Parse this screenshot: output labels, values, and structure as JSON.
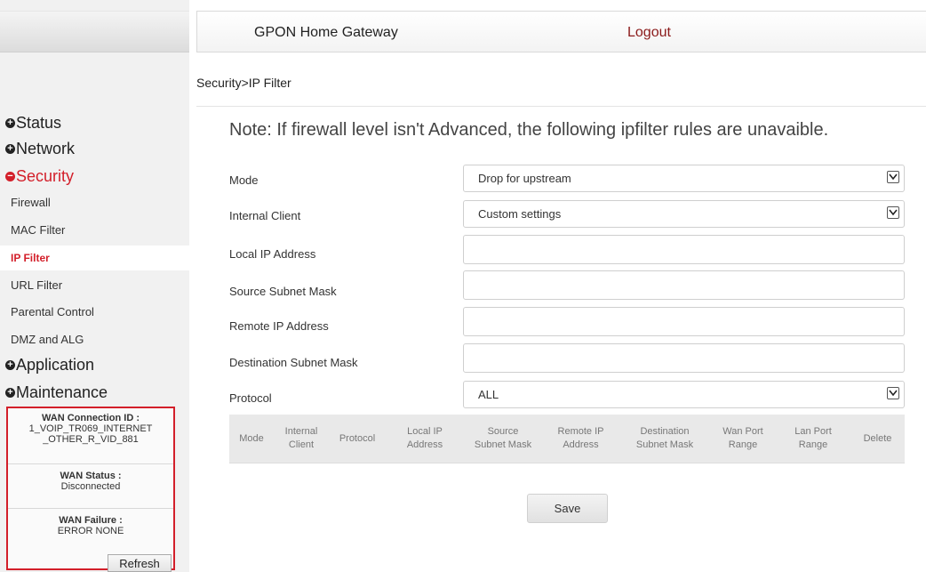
{
  "header": {
    "title": "GPON Home Gateway",
    "logout": "Logout"
  },
  "breadcrumb": "Security>IP Filter",
  "sidebar": {
    "status": "Status",
    "network": "Network",
    "security": "Security",
    "sub": {
      "firewall": "Firewall",
      "mac_filter": "MAC Filter",
      "ip_filter": "IP Filter",
      "url_filter": "URL Filter",
      "parental_control": "Parental Control",
      "dmz_alg": "DMZ and ALG"
    },
    "application": "Application",
    "maintenance": "Maintenance",
    "wan": {
      "conn_id_label": "WAN Connection ID :",
      "conn_id_line1": "1_VOIP_TR069_INTERNET",
      "conn_id_line2": "_OTHER_R_VID_881",
      "status_label": "WAN Status :",
      "status_value": "Disconnected",
      "failure_label": "WAN Failure :",
      "failure_value": "ERROR NONE",
      "refresh": "Refresh"
    }
  },
  "note": "Note: If firewall level isn't Advanced, the following ipfilter rules are unavaible.",
  "form": {
    "mode": {
      "label": "Mode",
      "value": "Drop for upstream"
    },
    "internal_client": {
      "label": "Internal Client",
      "value": "Custom settings"
    },
    "local_ip": {
      "label": "Local IP Address",
      "value": ""
    },
    "source_mask": {
      "label": "Source Subnet Mask",
      "value": ""
    },
    "remote_ip": {
      "label": "Remote IP Address",
      "value": ""
    },
    "dest_mask": {
      "label": "Destination Subnet Mask",
      "value": ""
    },
    "protocol": {
      "label": "Protocol",
      "value": "ALL"
    }
  },
  "table": {
    "columns": {
      "mode": "Mode",
      "internal_client_1": "Internal",
      "internal_client_2": "Client",
      "protocol": "Protocol",
      "local_ip_1": "Local IP",
      "local_ip_2": "Address",
      "source_mask_1": "Source",
      "source_mask_2": "Subnet Mask",
      "remote_ip_1": "Remote IP",
      "remote_ip_2": "Address",
      "dest_mask_1": "Destination",
      "dest_mask_2": "Subnet Mask",
      "wan_port_1": "Wan Port",
      "wan_port_2": "Range",
      "lan_port_1": "Lan Port",
      "lan_port_2": "Range",
      "delete": "Delete"
    }
  },
  "save": "Save",
  "colors": {
    "accent": "#d31f2a",
    "logout": "#8b1a1a",
    "table_header": "#e9e9e9"
  }
}
